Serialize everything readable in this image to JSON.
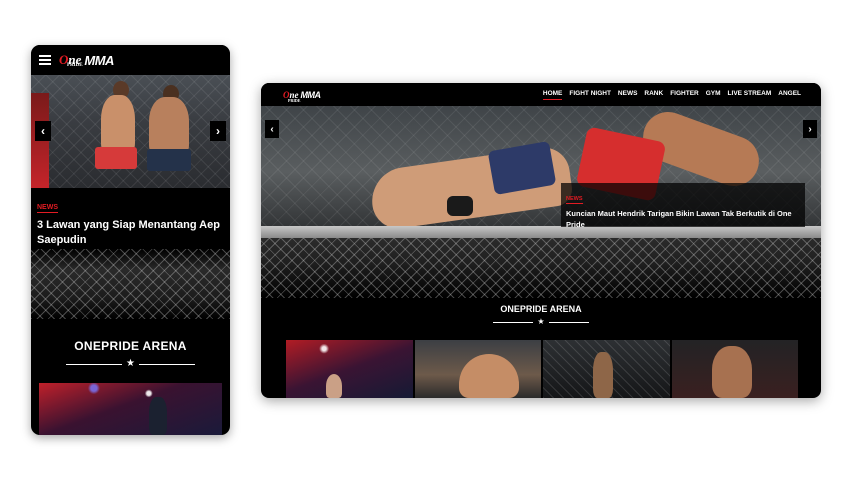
{
  "brand": {
    "one": "One",
    "pride": "PRIDE",
    "mma": "MMA"
  },
  "mobile": {
    "hero": {
      "tag": "News",
      "title": "3 Lawan yang Siap Menantang Aep Saepudin",
      "prev_icon": "‹",
      "next_icon": "›"
    },
    "section_title": "ONEPRIDE ARENA",
    "star": "★"
  },
  "desktop": {
    "nav": [
      "HOME",
      "FIGHT NIGHT",
      "NEWS",
      "RANK",
      "FIGHTER",
      "GYM",
      "LIVE STREAM",
      "ANGEL"
    ],
    "active_nav": "HOME",
    "hero": {
      "tag": "News",
      "title": "Kuncian Maut Hendrik Tarigan Bikin Lawan Tak Berkutik di One Pride",
      "prev_icon": "‹",
      "next_icon": "›"
    },
    "section_title": "ONEPRIDE ARENA",
    "star": "★"
  },
  "colors": {
    "accent": "#e31b23",
    "background": "#000000"
  }
}
